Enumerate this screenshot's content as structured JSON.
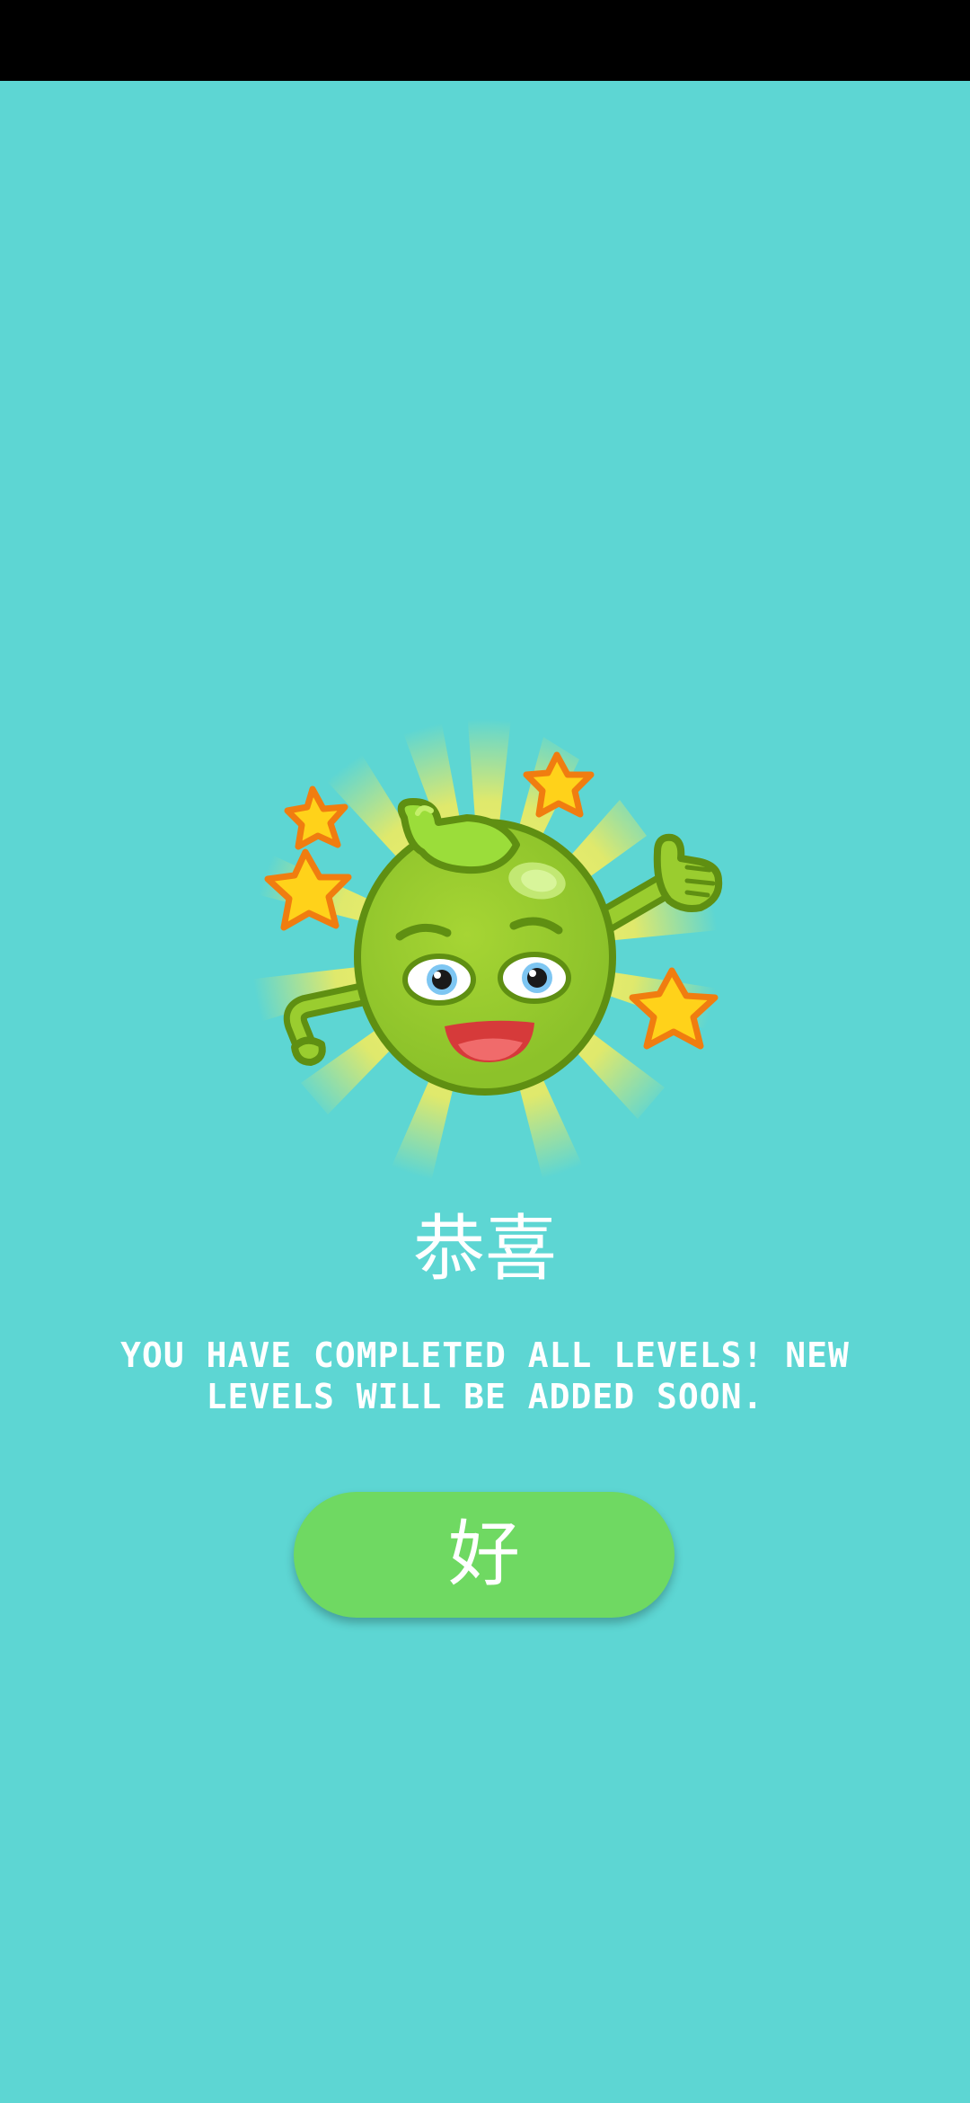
{
  "dialog": {
    "title": "恭喜",
    "message": "YOU HAVE COMPLETED ALL LEVELS! NEW LEVELS WILL BE ADDED SOON.",
    "ok_button_label": "好"
  },
  "mascot": {
    "icon": "celebrating-pea-mascot-icon",
    "star_icon": "star-icon"
  },
  "colors": {
    "background": "#5dd6d3",
    "status_bar": "#000000",
    "button": "#6fd962",
    "text": "#ffffff",
    "mascot_body": "#9acd2f",
    "star": "#ffd21a"
  }
}
